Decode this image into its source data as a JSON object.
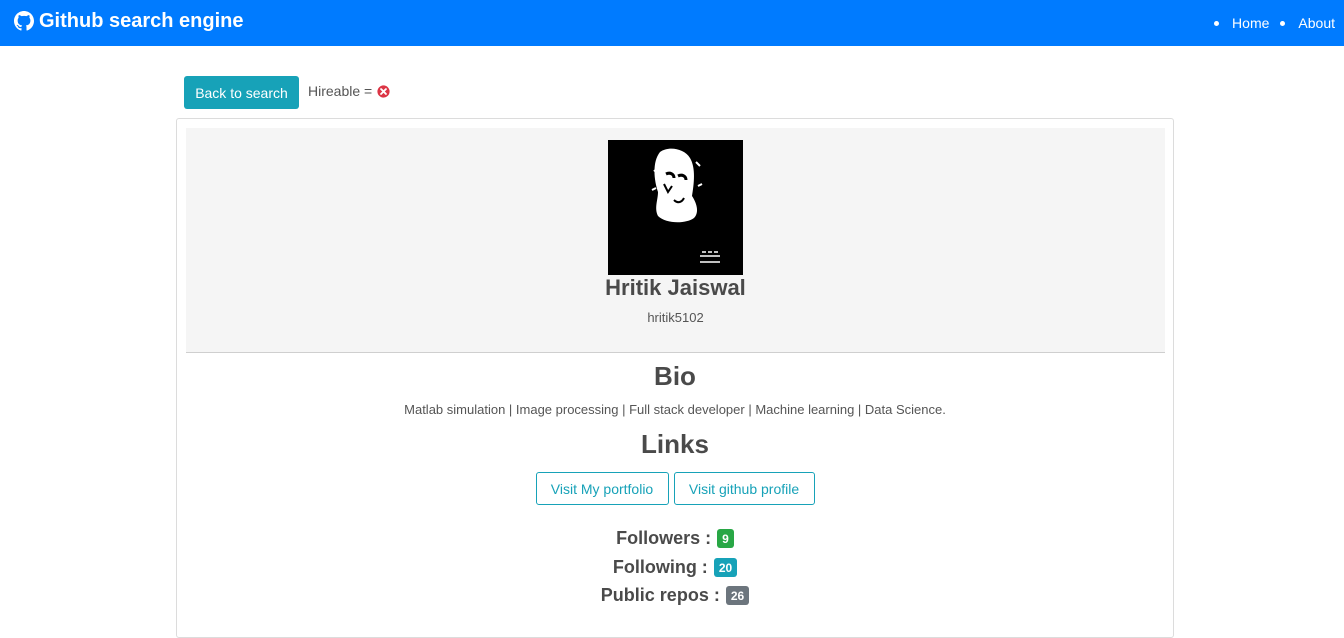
{
  "navbar": {
    "brand": "Github search engine",
    "links": [
      "Home",
      "About"
    ]
  },
  "actions": {
    "back_label": "Back to search",
    "hireable_label": "Hireable ="
  },
  "profile": {
    "name": "Hritik Jaiswal",
    "login": "hritik5102"
  },
  "bio": {
    "heading": "Bio",
    "text": "Matlab simulation | Image processing | Full stack developer | Machine learning | Data Science."
  },
  "links": {
    "heading": "Links",
    "portfolio_label": "Visit My portfolio",
    "github_label": "Visit github profile"
  },
  "stats": [
    {
      "label": "Followers :",
      "value": "9",
      "color": "#28a745"
    },
    {
      "label": "Following :",
      "value": "20",
      "color": "#17a2b8"
    },
    {
      "label": "Public repos :",
      "value": "26",
      "color": "#6c757d"
    }
  ],
  "colors": {
    "navbar": "#007bff",
    "accent": "#17a2b8",
    "not_hireable": "#dc3545"
  },
  "icons": {
    "brand": "github-icon",
    "hireable": "x-circle-icon"
  }
}
